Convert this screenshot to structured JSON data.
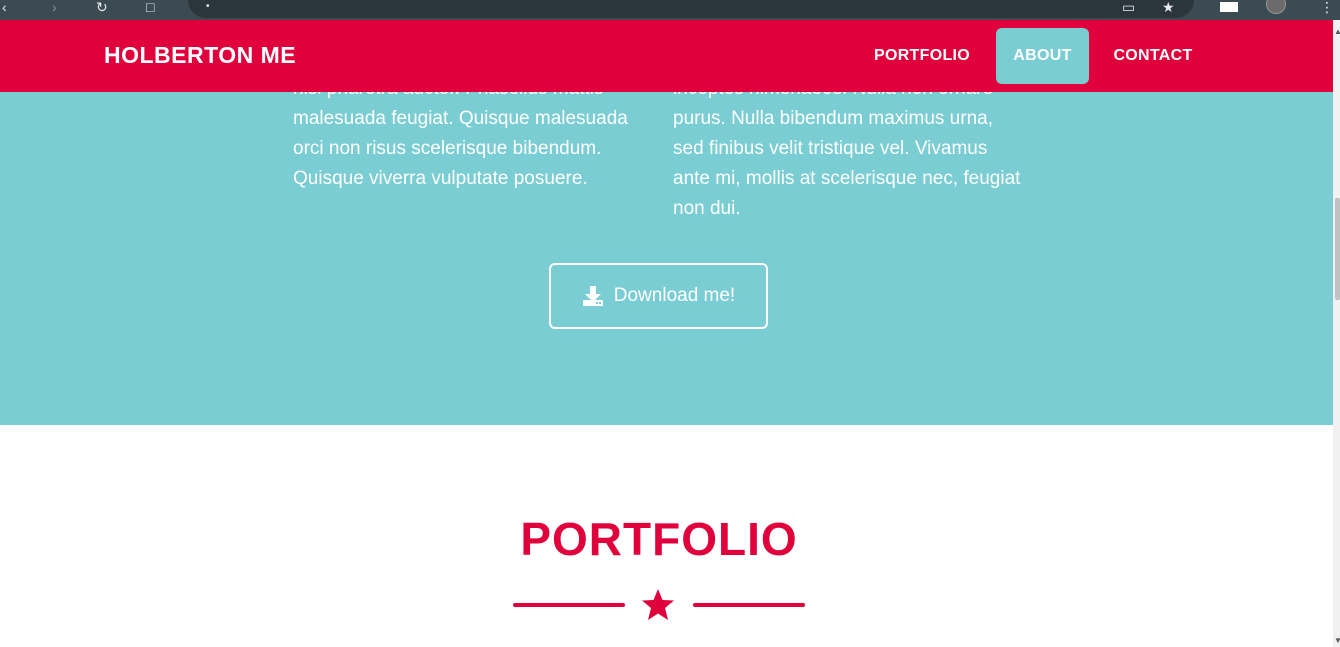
{
  "nav": {
    "brand": "HOLBERTON ME",
    "items": [
      {
        "label": "PORTFOLIO"
      },
      {
        "label": "ABOUT"
      },
      {
        "label": "CONTACT"
      }
    ],
    "active": "ABOUT"
  },
  "about": {
    "left_text": "nisi pharetra auctor. Phasellus mattis malesuada feugiat. Quisque malesuada orci non risus scelerisque bibendum. Quisque viverra vulputate posuere.",
    "right_text": "inceptos himenaeos. Nulla non ornare purus. Nulla bibendum maximus urna, sed finibus velit tristique vel. Vivamus ante mi, mollis at scelerisque nec, feugiat non dui.",
    "download_label": "Download me!"
  },
  "portfolio": {
    "title": "PORTFOLIO"
  },
  "colors": {
    "primary": "#e0003b",
    "accent": "#79cdd3",
    "white": "#ffffff"
  },
  "icons": {
    "download": "download-icon",
    "star": "star-icon"
  }
}
